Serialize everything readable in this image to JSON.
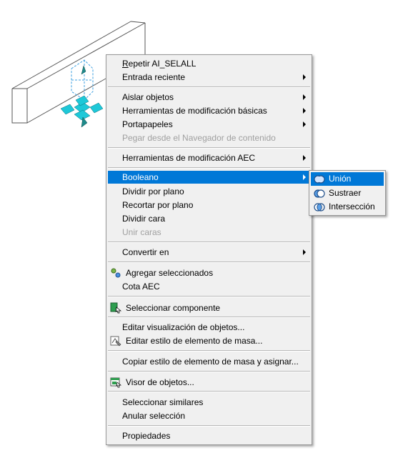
{
  "context_menu": {
    "items": [
      {
        "label": "Repetir AI_SELALL",
        "underline": "R"
      },
      {
        "label": "Entrada reciente",
        "submenu": true
      },
      {
        "label": "Aislar objetos",
        "submenu": true
      },
      {
        "label": "Herramientas de modificación básicas",
        "submenu": true
      },
      {
        "label": "Portapapeles",
        "submenu": true
      },
      {
        "label": "Pegar desde el Navegador de contenido",
        "disabled": true
      },
      {
        "label": "Herramientas de modificación AEC",
        "submenu": true
      },
      {
        "label": "Booleano",
        "submenu": true,
        "selected": true
      },
      {
        "label": "Dividir por plano"
      },
      {
        "label": "Recortar por plano"
      },
      {
        "label": "Dividir cara"
      },
      {
        "label": "Unir caras",
        "disabled": true
      },
      {
        "label": "Convertir en",
        "submenu": true
      },
      {
        "label": "Agregar seleccionados",
        "icon": "add-selected-icon"
      },
      {
        "label": "Cota AEC"
      },
      {
        "label": "Seleccionar componente",
        "icon": "select-component-icon"
      },
      {
        "label": "Editar visualización de objetos..."
      },
      {
        "label": "Editar estilo de elemento de masa...",
        "icon": "edit-style-icon"
      },
      {
        "label": "Copiar estilo de elemento de masa y asignar..."
      },
      {
        "label": "Visor de objetos...",
        "icon": "object-viewer-icon"
      },
      {
        "label": "Seleccionar similares"
      },
      {
        "label": "Anular selección"
      },
      {
        "label": "Propiedades"
      }
    ]
  },
  "boolean_submenu": {
    "items": [
      {
        "label": "Unión",
        "icon": "union-icon",
        "selected": true
      },
      {
        "label": "Sustraer",
        "icon": "subtract-icon"
      },
      {
        "label": "Intersección",
        "icon": "intersection-icon"
      }
    ]
  },
  "colors": {
    "highlight": "#0078d7",
    "grip": "#1ec8d8",
    "wireframe": "#555555"
  }
}
